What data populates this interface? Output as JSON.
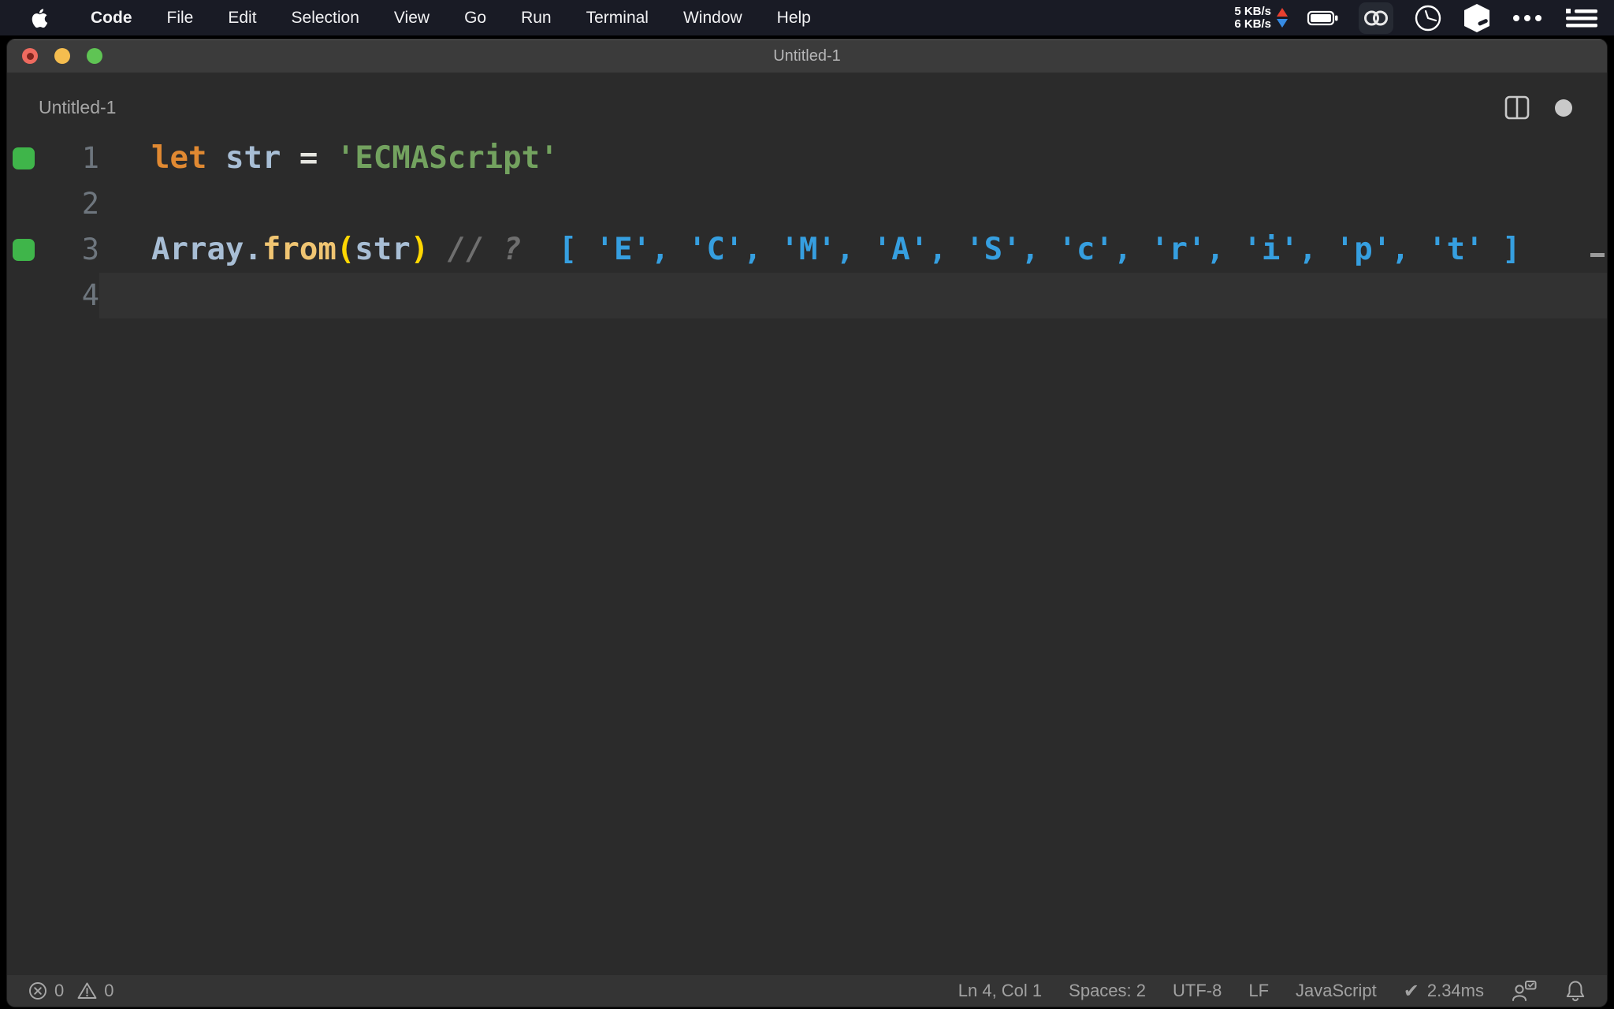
{
  "theme": {
    "coverage_green": "#3FB54A",
    "value_blue": "#369FE0",
    "tokens": {
      "keyword": "#E08932",
      "variable": "#A8BED5",
      "operator": "#E6E6E0",
      "string": "#73A25F",
      "function": "#F0C572",
      "bracket": "#FFD702",
      "comment": "#6F6F6F",
      "value": "#369FE0",
      "plain": "#D4D4D4"
    }
  },
  "menubar": {
    "app_menu": "Code",
    "items": [
      "File",
      "Edit",
      "Selection",
      "View",
      "Go",
      "Run",
      "Terminal",
      "Window",
      "Help"
    ],
    "network": {
      "up": "5 KB/s",
      "down": "6 KB/s"
    },
    "status_icons": [
      "battery-icon",
      "linked-rings-icon",
      "clock-icon",
      "cube-icon",
      "ellipsis-icon",
      "list-icon"
    ]
  },
  "window": {
    "title": "Untitled-1",
    "editor_label": "Untitled-1"
  },
  "editor": {
    "lines": [
      {
        "number": "1",
        "covered": true,
        "current": false,
        "tokens": [
          [
            "let",
            "keyword"
          ],
          [
            " ",
            "plain"
          ],
          [
            "str",
            "variable"
          ],
          [
            " ",
            "plain"
          ],
          [
            "=",
            "operator"
          ],
          [
            " ",
            "plain"
          ],
          [
            "'ECMAScript'",
            "string"
          ]
        ]
      },
      {
        "number": "2",
        "covered": false,
        "current": false,
        "tokens": []
      },
      {
        "number": "3",
        "covered": true,
        "current": false,
        "tokens": [
          [
            "Array.",
            "variable"
          ],
          [
            "from",
            "function"
          ],
          [
            "(",
            "bracket"
          ],
          [
            "str",
            "variable"
          ],
          [
            ")",
            "bracket"
          ],
          [
            " ",
            "plain"
          ],
          [
            "// ?",
            "comment"
          ],
          [
            "  ",
            "plain"
          ],
          [
            "[ 'E', 'C', 'M', 'A', 'S', 'c', 'r', 'i', 'p', 't' ]",
            "value"
          ]
        ]
      },
      {
        "number": "4",
        "covered": false,
        "current": true,
        "tokens": []
      }
    ]
  },
  "statusbar": {
    "errors": "0",
    "warnings": "0",
    "cursor": "Ln 4, Col 1",
    "indentation": "Spaces: 2",
    "encoding": "UTF-8",
    "eol": "LF",
    "language": "JavaScript",
    "quokka_check": "✔",
    "quokka_time": "2.34ms"
  }
}
